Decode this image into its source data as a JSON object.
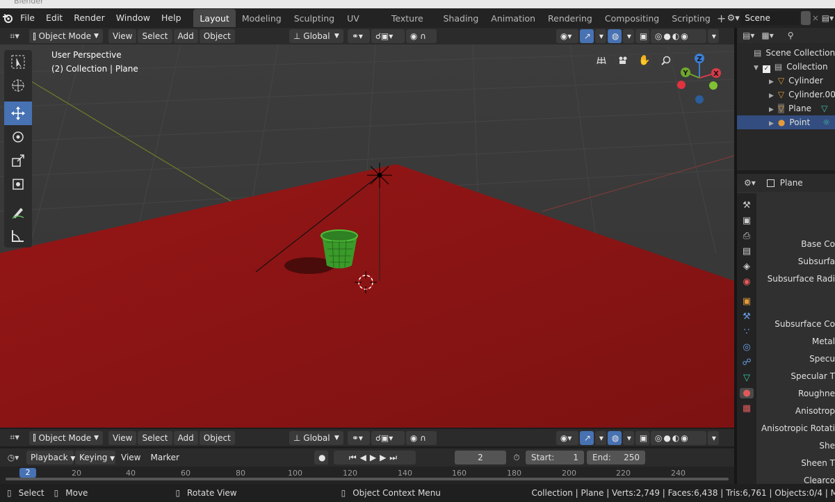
{
  "window_title": "Blender",
  "top_menu": [
    "File",
    "Edit",
    "Render",
    "Window",
    "Help"
  ],
  "workspace_tabs": [
    "Layout",
    "Modeling",
    "Sculpting",
    "UV Editing",
    "Texture Paint",
    "Shading",
    "Animation",
    "Rendering",
    "Compositing",
    "Scripting"
  ],
  "active_workspace": "Layout",
  "scene_name": "Scene",
  "viewport_header": {
    "mode": "Object Mode",
    "menus": [
      "View",
      "Select",
      "Add",
      "Object"
    ],
    "orientation": "Global"
  },
  "viewport": {
    "perspective_label": "User Perspective",
    "collection_label": "(2) Collection | Plane",
    "gizmo_axes": [
      "X",
      "Y",
      "Z"
    ],
    "floor_color": "#8e1414",
    "grid_color": "#3d3d3d"
  },
  "bottom_header": {
    "mode": "Object Mode",
    "menus": [
      "View",
      "Select",
      "Add",
      "Object"
    ],
    "orientation": "Global"
  },
  "outliner": {
    "root": "Scene Collection",
    "collection": "Collection",
    "items": [
      "Cylinder",
      "Cylinder.00",
      "Plane",
      "Point"
    ],
    "selected": "Point"
  },
  "properties": {
    "object_name": "Plane",
    "labels": [
      "Base Co",
      "Subsurfa",
      "Subsurface Radi",
      "Subsurface Co",
      "Metal",
      "Specu",
      "Specular T",
      "Roughne",
      "Anisotrop",
      "Anisotropic Rotati",
      "She",
      "Sheen T",
      "Clearco"
    ]
  },
  "timeline": {
    "menus": [
      "Playback",
      "Keying",
      "View",
      "Marker"
    ],
    "current_frame": "2",
    "start_label": "Start:",
    "start": "1",
    "end_label": "End:",
    "end": "250",
    "ruler_ticks": [
      "2",
      "20",
      "40",
      "60",
      "80",
      "100",
      "120",
      "140",
      "160",
      "180",
      "200",
      "220",
      "240"
    ]
  },
  "statusbar": {
    "select": "Select",
    "move": "Move",
    "rotate": "Rotate View",
    "context": "Object Context Menu",
    "stats": "Collection | Plane | Verts:2,749 | Faces:6,438 | Tris:6,761 | Objects:0/4 | M"
  }
}
